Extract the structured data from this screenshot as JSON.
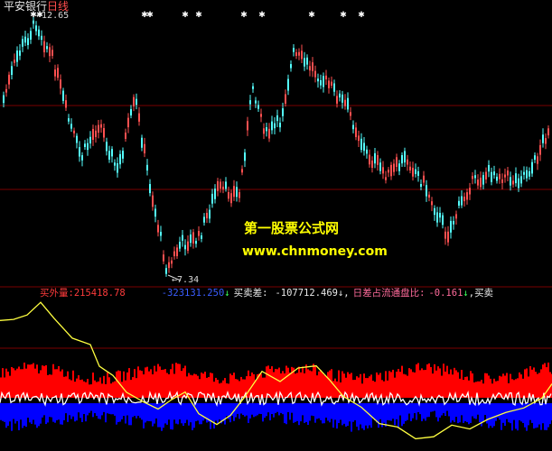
{
  "header": {
    "stock_name": "平安银行",
    "period": "日线"
  },
  "price_panel": {
    "high_label": "12.65",
    "low_label": "7.34"
  },
  "watermark": {
    "line1": "第一股票公式网",
    "line2": "www.chnmoney.com"
  },
  "indicator_bar": {
    "buy_out_label": "买外量:",
    "buy_out_value": "215418.78",
    "sell_in_label": "",
    "sell_in_value": "-323131.250",
    "diff_label": "买卖差:",
    "diff_value": "-107712.469",
    "ratio_label": "日差占流通盘比:",
    "ratio_value": "-0.161",
    "tail_label": "买卖"
  },
  "colors": {
    "background": "#000000",
    "up_candle": "#ff5050",
    "down_candle": "#54ffff",
    "grid_line": "#7a0000",
    "watermark": "#ffff00",
    "buy_volume": "#ff0000",
    "sell_volume": "#0000ff",
    "net_line": "#ffffff",
    "cumulative_line": "#ffff40"
  }
}
